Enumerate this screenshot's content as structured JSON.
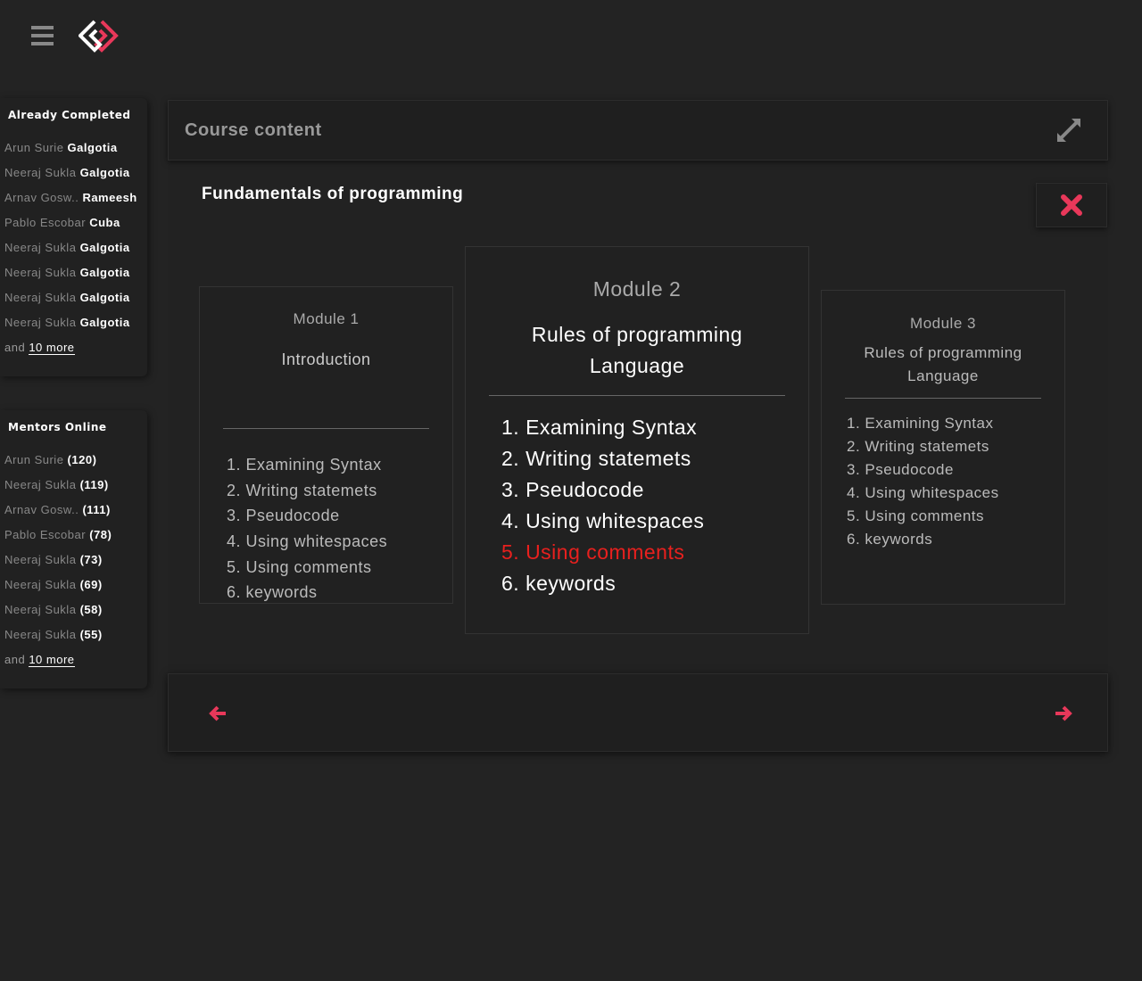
{
  "accent": "#e8385a",
  "completed": {
    "title": "Already Completed",
    "rows": [
      {
        "name": "Arun Surie",
        "org": "Galgotia"
      },
      {
        "name": "Neeraj Sukla",
        "org": "Galgotia"
      },
      {
        "name": "Arnav Gosw..",
        "org": "Rameesh"
      },
      {
        "name": "Pablo Escobar",
        "org": "Cuba"
      },
      {
        "name": "Neeraj Sukla",
        "org": "Galgotia"
      },
      {
        "name": "Neeraj Sukla",
        "org": "Galgotia"
      },
      {
        "name": "Neeraj Sukla",
        "org": "Galgotia"
      },
      {
        "name": "Neeraj Sukla",
        "org": "Galgotia"
      }
    ],
    "and": "and",
    "more": "10 more"
  },
  "mentors": {
    "title": "Mentors Online",
    "rows": [
      {
        "name": "Arun Surie ",
        "org": "(120)"
      },
      {
        "name": "Neeraj Sukla",
        "org": "(119)"
      },
      {
        "name": "Arnav Gosw..",
        "org": "(111)"
      },
      {
        "name": "Pablo Escobar",
        "org": "(78)"
      },
      {
        "name": "Neeraj Sukla",
        "org": "(73)"
      },
      {
        "name": "Neeraj Sukla",
        "org": "(69)"
      },
      {
        "name": "Neeraj Sukla",
        "org": "(58)"
      },
      {
        "name": "Neeraj Sukla",
        "org": "(55)"
      }
    ],
    "and": "and",
    "more": "10 more"
  },
  "panel": {
    "title": "Course content",
    "course": "Fundamentals of programming"
  },
  "modules": [
    {
      "label": "Module 1",
      "title": "Introduction",
      "items": [
        "1. Examining Syntax",
        "2. Writing statemets",
        "3. Pseudocode",
        "4. Using whitespaces",
        "5. Using comments",
        "6. keywords"
      ],
      "active": -1
    },
    {
      "label": "Module 2",
      "title": "Rules of programming Language",
      "items": [
        "1. Examining Syntax",
        "2. Writing statemets",
        "3. Pseudocode",
        "4. Using whitespaces",
        "5. Using comments",
        "6. keywords"
      ],
      "active": 4
    },
    {
      "label": "Module 3",
      "title": "Rules of programming Language",
      "items": [
        "1. Examining Syntax",
        "2. Writing statemets",
        "3. Pseudocode",
        "4. Using whitespaces",
        "5. Using comments",
        "6. keywords"
      ],
      "active": -1
    }
  ]
}
